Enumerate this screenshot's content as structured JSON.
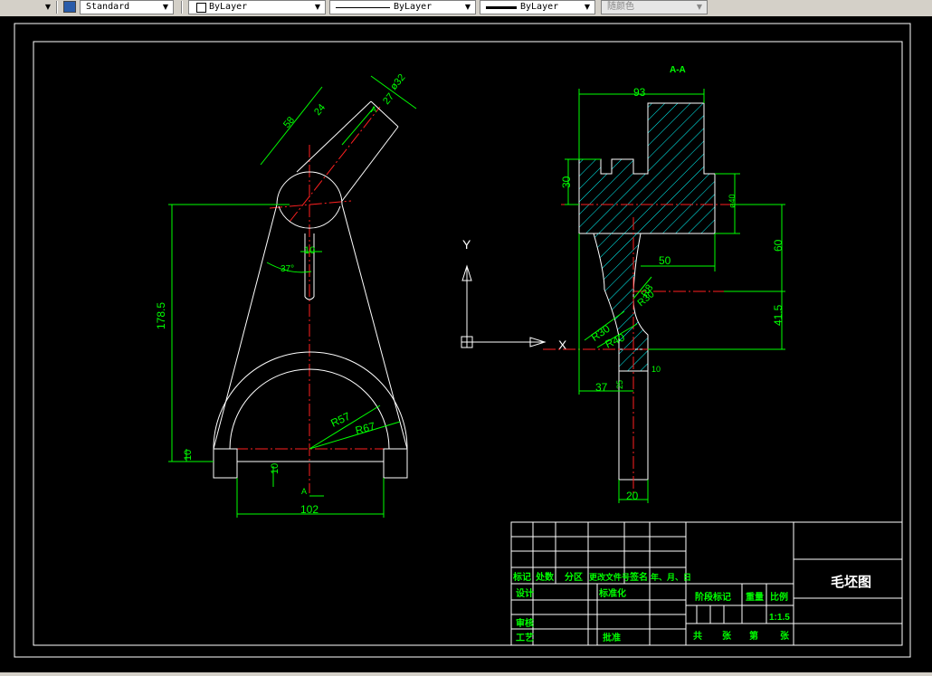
{
  "toolbar": {
    "text_style": "Standard",
    "layer": "ByLayer",
    "linetype": "ByLayer",
    "lineweight": "ByLayer",
    "color": "随颜色"
  },
  "drawing": {
    "section_label": "A-A",
    "view_label_top": "A",
    "view_label_bottom": "A",
    "axis_y": "Y",
    "axis_x": "X",
    "dims_left": {
      "d58": "58",
      "d24": "24",
      "d27": "27",
      "d32": "ø32",
      "d10_top": "10",
      "d37deg": "37°",
      "d178": "178.5",
      "d10a": "10",
      "d10b": "10",
      "r57": "R57",
      "r67": "R67",
      "d102": "102"
    },
    "dims_right": {
      "d93": "93",
      "d30": "30",
      "d40": "ø40",
      "d50": "50",
      "d60": "60",
      "d41": "41.5",
      "r8": "R8",
      "r30a": "R30",
      "r30b": "R30",
      "r40": "R40",
      "d37": "37",
      "d25": "25",
      "d10": "10",
      "d20": "20"
    }
  },
  "title_block": {
    "title": "毛坯图",
    "h_mark": "标记",
    "h_count": "处数",
    "h_zone": "分区",
    "h_docno": "更改文件号",
    "h_sign": "签名",
    "h_date": "年、月、日",
    "design": "设计",
    "standard": "标准化",
    "stage_mark": "阶段标记",
    "weight": "重量",
    "scale": "比例",
    "scale_value": "1:1.5",
    "review": "审核",
    "process": "工艺",
    "approve": "批准",
    "total": "共",
    "sheets1": "张",
    "page": "第",
    "sheets2": "张"
  }
}
